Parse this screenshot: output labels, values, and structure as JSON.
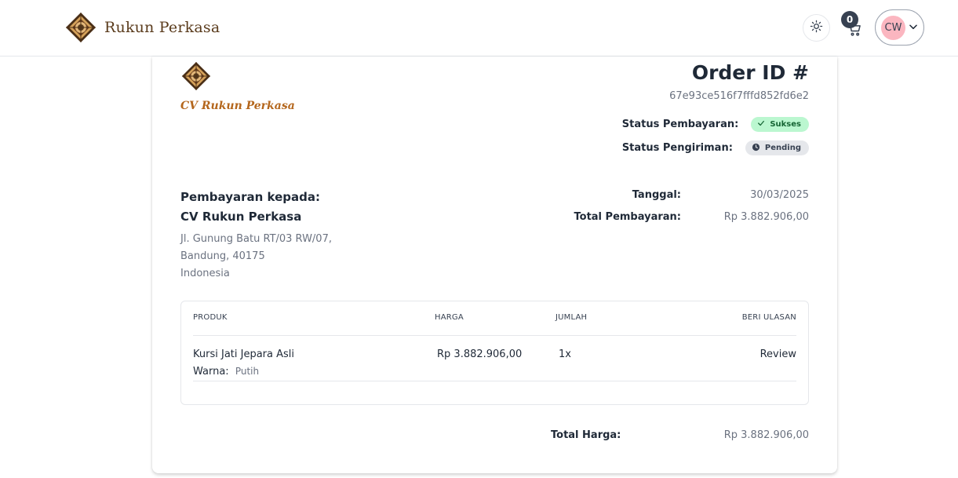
{
  "header": {
    "brand_name": "Rukun Perkasa",
    "cart_count": "0",
    "user_initials": "CW"
  },
  "invoice": {
    "company_script": "CV Rukun Perkasa",
    "title": "Order ID #",
    "order_id": "67e93ce516f7fffd852fd6e2",
    "payment_status_label": "Status Pembayaran:",
    "payment_status": "Sukses",
    "shipping_status_label": "Status Pengiriman:",
    "shipping_status": "Pending",
    "bill_to_label": "Pembayaran kepada:",
    "bill_to_company": "CV Rukun Perkasa",
    "address_lines": [
      "Jl. Gunung Batu RT/03 RW/07,",
      "Bandung, 40175",
      "Indonesia"
    ],
    "date_label": "Tanggal:",
    "date_value": "30/03/2025",
    "total_payment_label": "Total Pembayaran:",
    "total_payment_value": "Rp 3.882.906,00",
    "table": {
      "headers": [
        "PRODUK",
        "HARGA",
        "JUMLAH",
        "BERI ULASAN"
      ],
      "rows": [
        {
          "product": "Kursi Jati Jepara Asli",
          "color_label": "Warna:",
          "color_value": "Putih",
          "price": "Rp 3.882.906,00",
          "qty": "1x",
          "action": "Review"
        }
      ]
    },
    "total_label": "Total Harga:",
    "total_value": "Rp 3.882.906,00"
  },
  "colors": {
    "brand_brown": "#5a3b1c",
    "script_orange": "#b4661c",
    "success_bg": "#bbf7d0",
    "pending_bg": "#e5e7eb",
    "avatar_bg": "#fbb6c0"
  },
  "icons": {
    "theme": "sun-icon",
    "cart": "cart-icon",
    "user_menu": "chevron-down-icon",
    "success": "check-icon",
    "pending": "clock-icon"
  }
}
